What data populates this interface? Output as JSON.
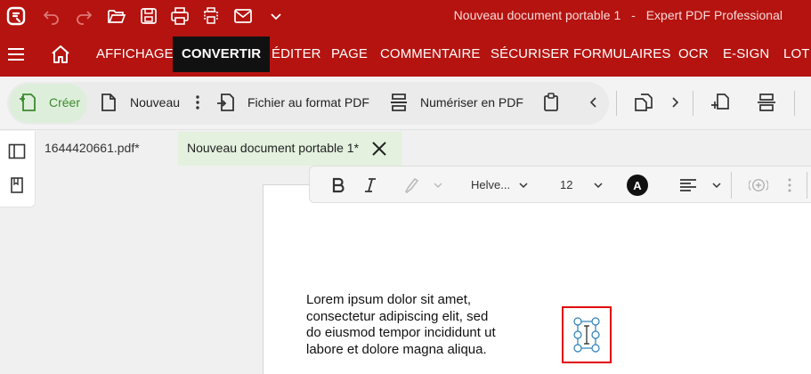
{
  "app": {
    "logo_icon": "expert-pdf-logo-icon",
    "doc_title": "Nouveau document portable 1",
    "separator": "-",
    "app_name": "Expert PDF Professional"
  },
  "quick_access": [
    "undo-icon",
    "redo-icon",
    "open-folder-icon",
    "save-icon",
    "print-icon",
    "batch-print-icon",
    "email-icon",
    "customize-chevron-icon"
  ],
  "menu": {
    "items": [
      "AFFICHAGE",
      "CONVERTIR",
      "ÉDITER",
      "PAGE",
      "COMMENTAIRE",
      "SÉCURISER",
      "FORMULAIRES",
      "OCR",
      "E-SIGN",
      "LOT"
    ],
    "active": "CONVERTIR"
  },
  "ribbon": {
    "create_label": "Créer",
    "new_label": "Nouveau",
    "to_pdf_label": "Fichier au format PDF",
    "scan_label": "Numériser en PDF"
  },
  "tabs": {
    "file_tab": "1644420661.pdf*",
    "doc_tab": "Nouveau document portable 1*"
  },
  "format_toolbar": {
    "font": "Helve...",
    "size": "12",
    "color_letter": "A"
  },
  "document": {
    "lines": [
      "Lorem ipsum dolor sit amet,",
      "consectetur adipiscing elit, sed",
      "do eiusmod tempor incididunt ut",
      "labore et dolore magna aliqua."
    ]
  },
  "colors": {
    "brand": "#b5130f",
    "active_menu": "#111111",
    "create_bg": "#ddefdb",
    "selection": "#e00000"
  }
}
